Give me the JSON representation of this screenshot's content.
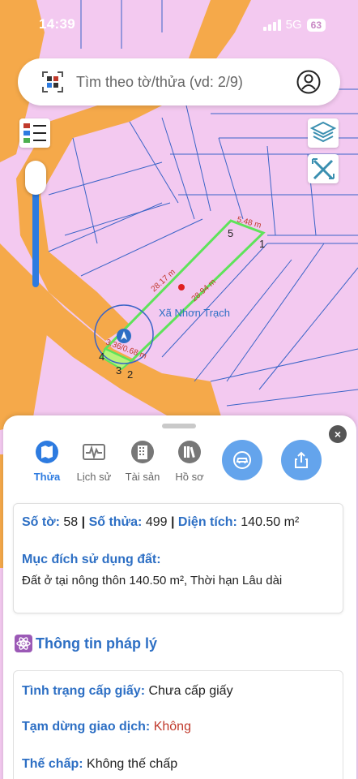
{
  "status_bar": {
    "time": "14:39",
    "network": "5G",
    "battery": "63"
  },
  "search": {
    "placeholder": "Tìm theo tờ/thửa (vd: 2/9)"
  },
  "icons": {
    "qr": "qr-scan-icon",
    "user": "user-profile-icon",
    "legend": "legend-list-icon",
    "layers": "layers-icon",
    "measure": "measure-tool-icon",
    "location": "location-arrow-icon"
  },
  "map": {
    "place_label": "Xã Nhơn Trạch",
    "edge_labels": [
      "5.48 m",
      "28.17 m",
      "28.94 m",
      "3.36/0.68 m"
    ],
    "vertex_labels": [
      "1",
      "2",
      "3",
      "4",
      "5"
    ]
  },
  "tabs": [
    {
      "label": "Thửa",
      "active": true
    },
    {
      "label": "Lịch sử",
      "active": false
    },
    {
      "label": "Tài sản",
      "active": false
    },
    {
      "label": "Hồ sơ",
      "active": false
    }
  ],
  "actions": {
    "car": "car-icon",
    "share": "share-icon"
  },
  "close_label": "×",
  "parcel": {
    "sheet_label": "Số tờ:",
    "sheet_value": "58",
    "parcel_label": "Số thửa:",
    "parcel_value": "499",
    "area_label": "Diện tích:",
    "area_value": "140.50 m²",
    "sep": "|",
    "purpose_label": "Mục đích sử dụng đất:",
    "purpose_value": "Đất ở tại nông thôn 140.50 m², Thời hạn Lâu dài"
  },
  "legal": {
    "title": "Thông tin pháp lý",
    "status_label": "Tình trạng cấp giấy:",
    "status_value": "Chưa cấp giấy",
    "suspend_label": "Tạm dừng giao dịch:",
    "suspend_value": "Không",
    "mortgage_label": "Thế chấp:",
    "mortgage_value": "Không thế chấp"
  },
  "colors": {
    "map_bg": "#f3c9f0",
    "road": "#f5a94a",
    "parcel_outline": "#5ee35a",
    "lines": "#3a64c7",
    "accent": "#2d7be0",
    "label_blue": "#2d6fc4",
    "alert_red": "#c0392b"
  }
}
